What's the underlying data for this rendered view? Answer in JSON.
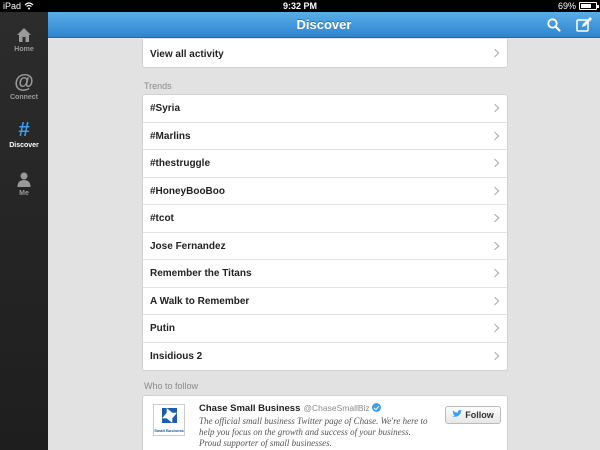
{
  "status_bar": {
    "device": "iPad",
    "time": "9:32 PM",
    "battery_text": "69%",
    "battery_level": 0.69
  },
  "sidebar": {
    "items": [
      {
        "label": "Home",
        "icon": "home-icon",
        "active": false
      },
      {
        "label": "Connect",
        "icon": "at-icon",
        "active": false
      },
      {
        "label": "Discover",
        "icon": "hash-icon",
        "active": true
      },
      {
        "label": "Me",
        "icon": "person-icon",
        "active": false
      }
    ]
  },
  "header": {
    "title": "Discover",
    "search_icon": "search-icon",
    "compose_icon": "compose-icon"
  },
  "activity": {
    "label": "View all activity"
  },
  "trends": {
    "title": "Trends",
    "items": [
      "#Syria",
      "#Marlins",
      "#thestruggle",
      "#HoneyBooBoo",
      "#tcot",
      "Jose Fernandez",
      "Remember the Titans",
      "A Walk to Remember",
      "Putin",
      "Insidious 2"
    ]
  },
  "who_to_follow": {
    "title": "Who to follow",
    "user": {
      "name": "Chase Small Business",
      "handle": "@ChaseSmallBiz",
      "logo_text": "Small Business",
      "bio": "The official small business Twitter page of Chase. We're here to help you focus on the growth and success of your business. Proud supporter of small businesses.",
      "follow_label": "Follow"
    }
  },
  "colors": {
    "accent": "#3a9ef5",
    "header_top": "#59aee8",
    "header_bottom": "#2f84cf"
  }
}
